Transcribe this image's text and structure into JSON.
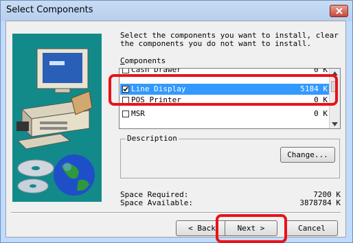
{
  "window": {
    "title": "Select Components",
    "close_icon": "close-icon"
  },
  "instructions": "Select the components you want to install, clear\nthe components you do not want to install.",
  "components": {
    "label": "Components",
    "items": [
      {
        "name": "Cash Drawer",
        "size": "0 K",
        "checked": false,
        "selected": false
      },
      {
        "name": "Line Display",
        "size": "5184 K",
        "checked": true,
        "selected": true
      },
      {
        "name": "POS Printer",
        "size": "0 K",
        "checked": false,
        "selected": false
      },
      {
        "name": "MSR",
        "size": "0 K",
        "checked": false,
        "selected": false
      }
    ]
  },
  "description": {
    "label": "Description",
    "change_button": "Change..."
  },
  "space": {
    "required_label": "Space Required:",
    "required_value": "7200 K",
    "available_label": "Space Available:",
    "available_value": "3878784 K"
  },
  "buttons": {
    "back": "< Back",
    "next": "Next >",
    "cancel": "Cancel"
  },
  "colors": {
    "highlight": "#e8121a",
    "selection": "#3399ff",
    "art_background": "#138a8a"
  }
}
